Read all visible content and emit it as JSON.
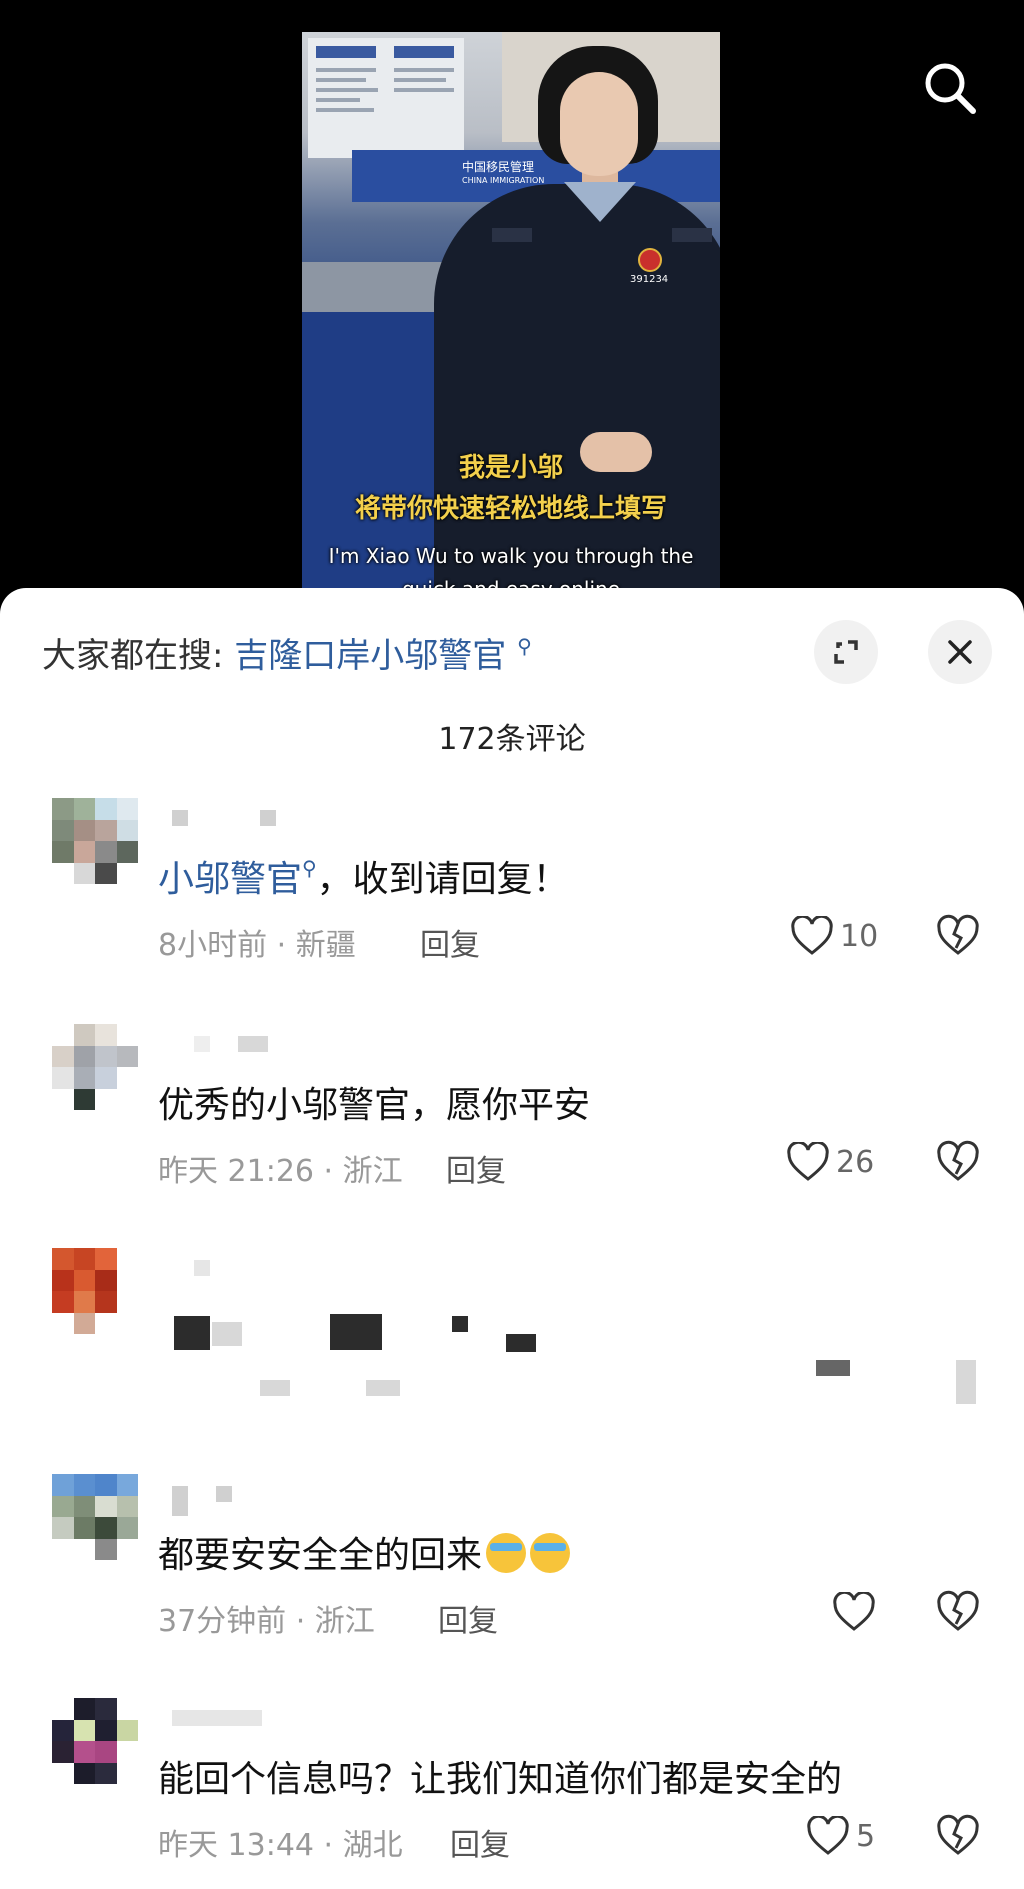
{
  "video": {
    "subtitle_line1": "我是小邬",
    "subtitle_line2": "将带你快速轻松地线上填写",
    "subtitle_line3": "I'm Xiao Wu to walk you through the",
    "subtitle_line4": "quick and easy online",
    "badge_number": "391234",
    "banner_cn": "中国移民管理",
    "banner_en": "CHINA IMMIGRATION"
  },
  "search_icon": "search-icon",
  "sheet": {
    "search_prefix": "大家都在搜:",
    "search_keyword": "吉隆口岸小邬警官",
    "expand_icon": "expand-icon",
    "close_icon": "close-icon",
    "comment_count": "172条评论"
  },
  "comments": [
    {
      "mention": "小邬警官",
      "text": "，收到请回复！",
      "meta": "8小时前 · 新疆",
      "reply": "回复",
      "likes": "10"
    },
    {
      "text": "优秀的小邬警官，愿你平安",
      "meta": "昨天 21:26 · 浙江",
      "reply": "回复",
      "likes": "26"
    },
    {
      "text": "",
      "meta": "",
      "reply": "",
      "likes": ""
    },
    {
      "text": "都要安安全全的回来",
      "meta": "37分钟前 · 浙江",
      "reply": "回复",
      "likes": ""
    },
    {
      "text": "能回个信息吗？让我们知道你们都是安全的",
      "meta": "昨天 13:44 · 湖北",
      "reply": "回复",
      "likes": "5"
    }
  ],
  "colors": {
    "link": "#2f5d9c",
    "meta": "#999999",
    "subtitle": "#f3d04c"
  }
}
